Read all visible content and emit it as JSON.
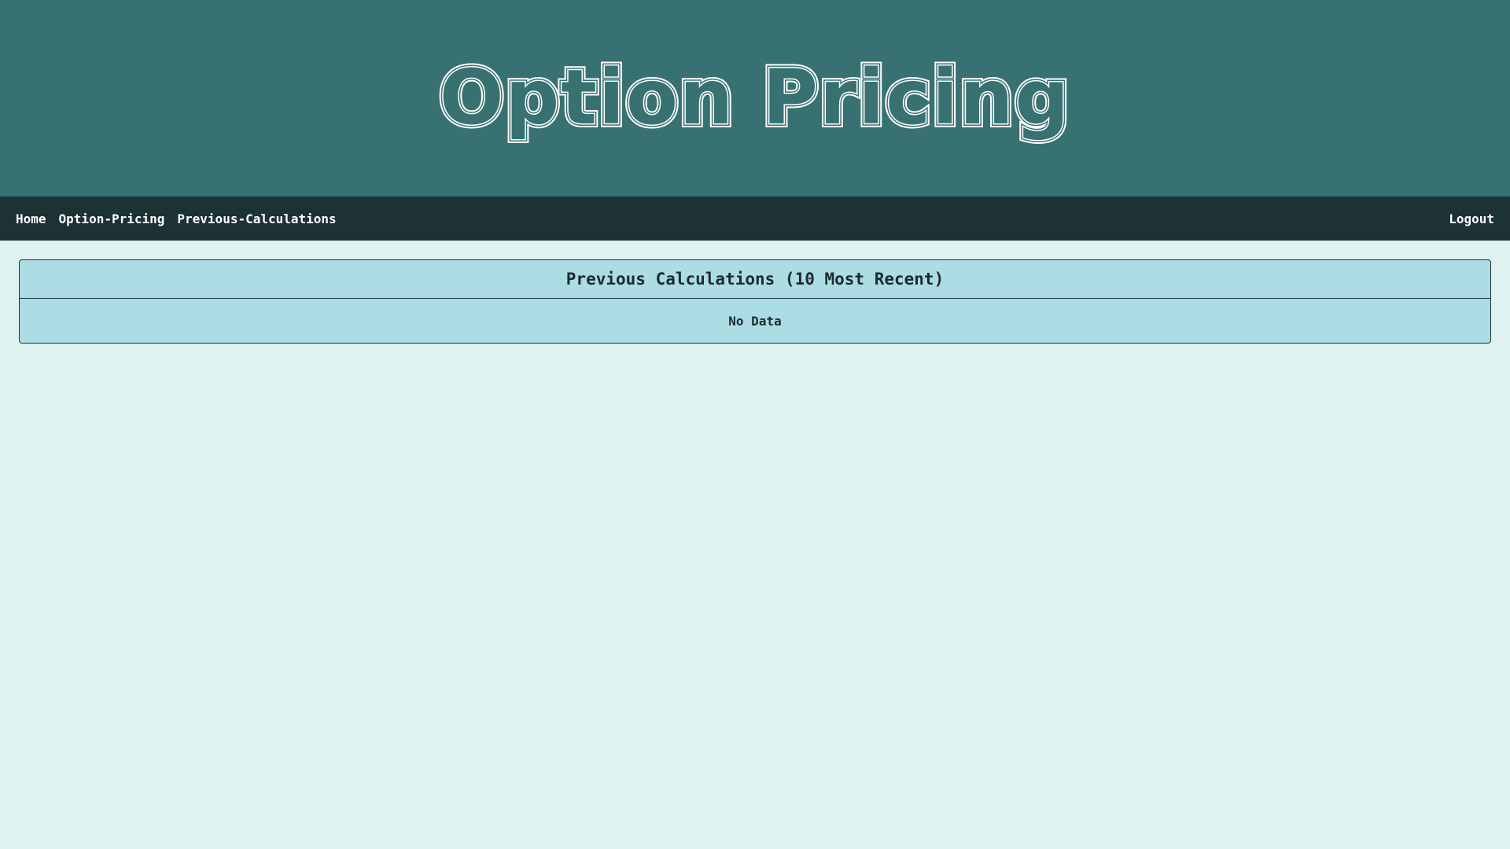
{
  "header": {
    "logo_text": "Option Pricing",
    "background_color": "#387171",
    "logo_color": "#ffffff"
  },
  "nav": {
    "links": [
      {
        "label": "Home"
      },
      {
        "label": "Option-Pricing"
      },
      {
        "label": "Previous-Calculations"
      }
    ],
    "logout_label": "Logout",
    "background_color": "#1c3235"
  },
  "main": {
    "panel": {
      "title": "Previous Calculations (10 Most Recent)",
      "empty_text": "No Data",
      "background_color": "#acdce4"
    },
    "background_color": "#dff2f0"
  }
}
